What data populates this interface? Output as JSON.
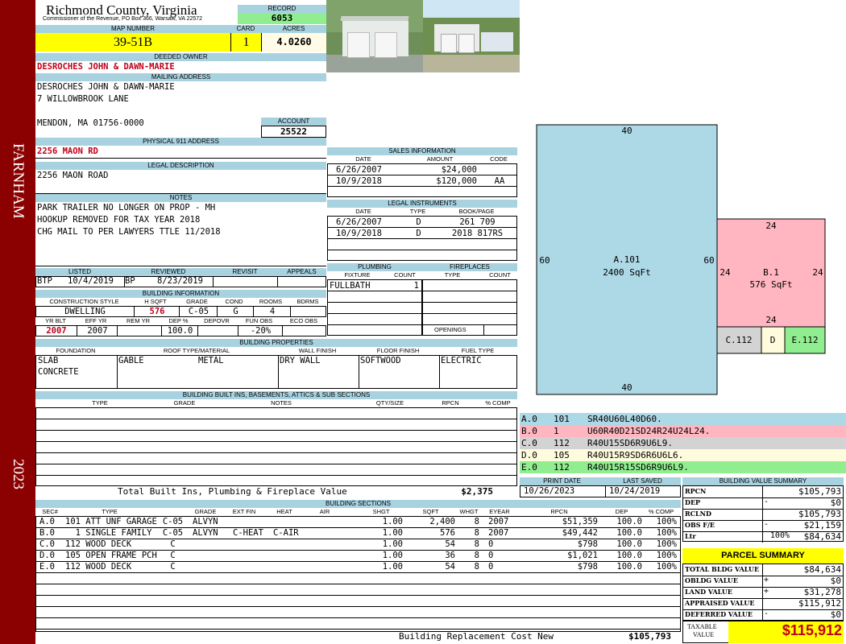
{
  "district": "FARNHAM",
  "year": "2023",
  "county": {
    "name": "Richmond County, Virginia",
    "address": "Commissioner of the Revenue, PO Box 366, Warsaw, VA 22572"
  },
  "record": {
    "label": "RECORD",
    "value": "6053"
  },
  "map_number": {
    "label": "MAP NUMBER",
    "value": "39-51B"
  },
  "card": {
    "label": "CARD",
    "value": "1"
  },
  "acres": {
    "label": "ACRES",
    "value": "4.0260"
  },
  "deeded_owner": {
    "label": "DEEDED OWNER",
    "value": "DESROCHES JOHN & DAWN-MARIE"
  },
  "mailing_address": {
    "label": "MAILING ADDRESS",
    "line1": "DESROCHES JOHN & DAWN-MARIE",
    "line2": "7 WILLOWBROOK LANE",
    "line3": "MENDON, MA 01756-0000"
  },
  "account": {
    "label": "ACCOUNT",
    "value": "25522"
  },
  "physical_address": {
    "label": "PHYSICAL 911 ADDRESS",
    "value": "2256 MAON RD"
  },
  "legal_description": {
    "label": "LEGAL DESCRIPTION",
    "value": "2256 MAON ROAD"
  },
  "notes": {
    "label": "NOTES",
    "lines": [
      "PARK TRAILER NO LONGER ON PROP - MH",
      "HOOKUP REMOVED FOR TAX YEAR 2018",
      "CHG MAIL TO PER LAWYERS TTLE 11/2018"
    ]
  },
  "review": {
    "headers": [
      "LISTED",
      "REVIEWED",
      "REVISIT",
      "APPEALS"
    ],
    "listed_by": "BTP",
    "listed_date": "10/4/2019",
    "reviewed_by": "BP",
    "reviewed_date": "8/23/2019"
  },
  "building_info": {
    "label": "BUILDING INFORMATION",
    "headers": [
      "CONSTRUCTION STYLE",
      "H SQFT",
      "GRADE",
      "COND",
      "ROOMS",
      "BDRMS"
    ],
    "values": [
      "DWELLING",
      "576",
      "C-05",
      "G",
      "4",
      ""
    ],
    "headers2": [
      "YR BLT",
      "EFF YR",
      "REM YR",
      "DEP %",
      "DEPOVR",
      "FUN OBS",
      "ECO OBS"
    ],
    "values2": [
      "2007",
      "2007",
      "",
      "100.0",
      "",
      "-20%",
      ""
    ]
  },
  "sales": {
    "label": "SALES INFORMATION",
    "headers": [
      "DATE",
      "AMOUNT",
      "CODE"
    ],
    "rows": [
      [
        "6/26/2007",
        "$24,000",
        ""
      ],
      [
        "10/9/2018",
        "$120,000",
        "AA"
      ]
    ]
  },
  "legal_instruments": {
    "label": "LEGAL INSTRUMENTS",
    "headers": [
      "DATE",
      "TYPE",
      "BOOK/PAGE"
    ],
    "rows": [
      [
        "6/26/2007",
        "D",
        "261 709"
      ],
      [
        "10/9/2018",
        "D",
        "2018 817RS"
      ]
    ]
  },
  "plumbing": {
    "label": "PLUMBING",
    "headers": [
      "FIXTURE",
      "COUNT"
    ],
    "rows": [
      [
        "FULLBATH",
        "1"
      ]
    ]
  },
  "fireplaces": {
    "label": "FIREPLACES",
    "headers": [
      "TYPE",
      "COUNT"
    ],
    "openings_label": "OPENINGS"
  },
  "building_properties": {
    "label": "BUILDING PROPERTIES",
    "headers": [
      "FOUNDATION",
      "ROOF TYPE/MATERIAL",
      "WALL FINISH",
      "FLOOR FINISH",
      "FUEL TYPE"
    ],
    "foundation": [
      "SLAB",
      "CONCRETE"
    ],
    "roof_type": "GABLE",
    "roof_material": "METAL",
    "wall": "DRY WALL",
    "floor": "SOFTWOOD",
    "fuel": "ELECTRIC"
  },
  "built_ins": {
    "label": "BUILDING BUILT INS, BASEMENTS, ATTICS & SUB SECTIONS",
    "headers": [
      "TYPE",
      "GRADE",
      "NOTES",
      "QTY/SIZE",
      "RPCN",
      "% COMP"
    ],
    "total_label": "Total Built Ins, Plumbing & Fireplace Value",
    "total_value": "$2,375"
  },
  "sketch": {
    "a": {
      "label": "A.101",
      "area": "2400 SqFt",
      "top": "40",
      "bottom": "40",
      "left": "60",
      "right": "60"
    },
    "b": {
      "label": "B.1",
      "area": "576 SqFt",
      "top": "24",
      "bottom": "24",
      "left": "24",
      "right": "24"
    },
    "c": "C.112",
    "d": "D",
    "e": "E.112"
  },
  "sketch_codes": [
    {
      "sec": "A.0",
      "code": "101",
      "vector": "SR40U60L40D60.",
      "color": "#add8e6"
    },
    {
      "sec": "B.0",
      "code": "1",
      "vector": "U60R40D21SD24R24U24L24.",
      "color": "#ffb6c1"
    },
    {
      "sec": "C.0",
      "code": "112",
      "vector": "R40U15SD6R9U6L9.",
      "color": "#d3d3d3"
    },
    {
      "sec": "D.0",
      "code": "105",
      "vector": "R40U15R9SD6R6U6L6.",
      "color": "#fffbdd"
    },
    {
      "sec": "E.0",
      "code": "112",
      "vector": "R40U15R15SD6R9U6L9.",
      "color": "#90ee90"
    }
  ],
  "print_date": {
    "label": "PRINT DATE",
    "value": "10/26/2023"
  },
  "last_saved": {
    "label": "LAST SAVED",
    "value": "10/24/2019"
  },
  "building_sections": {
    "label": "BUILDING SECTIONS",
    "headers": [
      "SEC#",
      "TYPE",
      "GRADE",
      "EXT FIN",
      "HEAT",
      "AIR",
      "SHGT",
      "SQFT",
      "WHGT",
      "EYEAR",
      "RPCN",
      "DEP",
      "% COMP"
    ],
    "rows": [
      [
        "A.0",
        "101 ATT UNF GARAGE",
        "C-05",
        "ALVYN",
        "",
        "",
        "1.00",
        "2,400",
        "8",
        "2007",
        "$51,359",
        "100.0",
        "100%"
      ],
      [
        "B.0",
        "  1 SINGLE FAMILY",
        "C-05",
        "ALVYN",
        "C-HEAT",
        "C-AIR",
        "1.00",
        "576",
        "8",
        "2007",
        "$49,442",
        "100.0",
        "100%"
      ],
      [
        "C.0",
        "112 WOOD DECK",
        "C",
        "",
        "",
        "",
        "1.00",
        "54",
        "8",
        "0",
        "$798",
        "100.0",
        "100%"
      ],
      [
        "D.0",
        "105 OPEN FRAME PCH",
        "C",
        "",
        "",
        "",
        "1.00",
        "36",
        "8",
        "0",
        "$1,021",
        "100.0",
        "100%"
      ],
      [
        "E.0",
        "112 WOOD DECK",
        "C",
        "",
        "",
        "",
        "1.00",
        "54",
        "8",
        "0",
        "$798",
        "100.0",
        "100%"
      ]
    ],
    "replacement_label": "Building Replacement Cost New",
    "replacement_value": "$105,793"
  },
  "building_value_summary": {
    "label": "BUILDING VALUE SUMMARY",
    "rows": [
      {
        "label": "RPCN",
        "sign": "",
        "value": "$105,793"
      },
      {
        "label": "DEP",
        "sign": "-",
        "value": "$0"
      },
      {
        "label": "RCLND",
        "sign": "",
        "value": "$105,793"
      },
      {
        "label": "OBS F/E",
        "sign": "-",
        "value": "$21,159"
      },
      {
        "label": "Ltr",
        "sign": "100%",
        "value": "$84,634"
      }
    ]
  },
  "parcel_summary": {
    "label": "PARCEL SUMMARY",
    "rows": [
      {
        "label": "TOTAL BLDG VALUE",
        "sign": "",
        "value": "$84,634"
      },
      {
        "label": "OBLDG VALUE",
        "sign": "+",
        "value": "$0"
      },
      {
        "label": "LAND VALUE",
        "sign": "+",
        "value": "$31,278"
      },
      {
        "label": "APPRAISED VALUE",
        "sign": "",
        "value": "$115,912"
      },
      {
        "label": "DEFERRED VALUE",
        "sign": "-",
        "value": "$0"
      }
    ],
    "taxable_label1": "TAXABLE",
    "taxable_label2": "VALUE",
    "taxable_value": "$115,912"
  }
}
